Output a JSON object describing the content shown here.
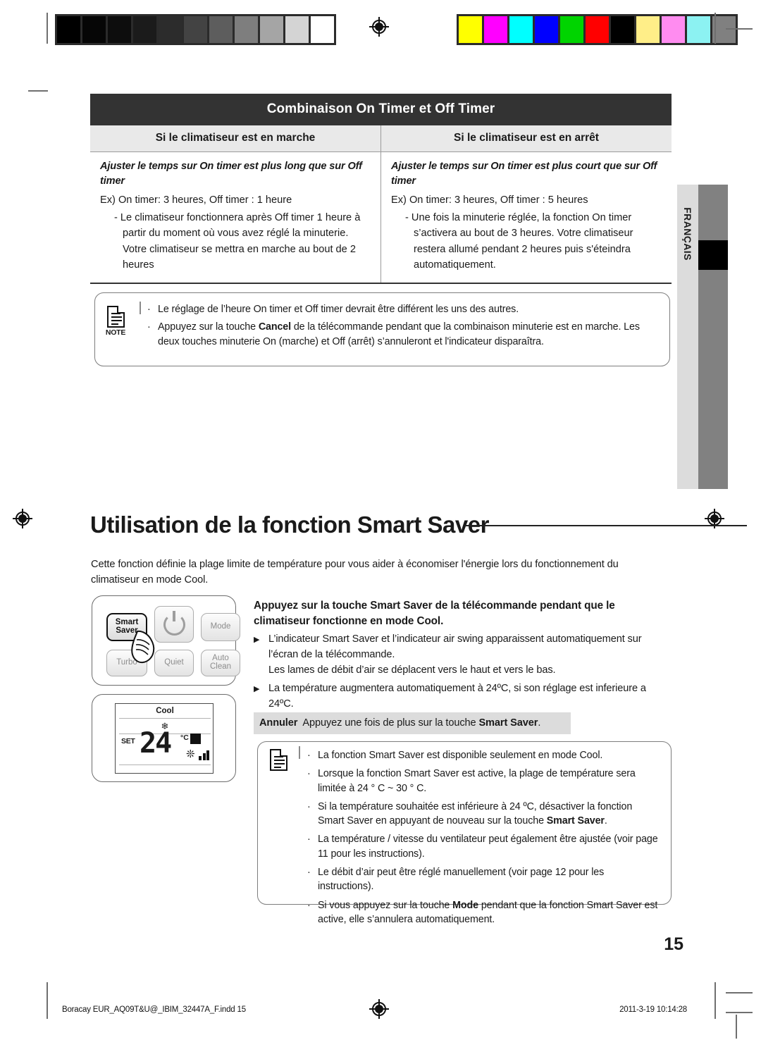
{
  "print_marks": {
    "gray_swatches": [
      "#000000",
      "#060606",
      "#0d0d0d",
      "#1b1b1b",
      "#2c2c2c",
      "#434343",
      "#5d5d5d",
      "#7e7e7e",
      "#a5a5a5",
      "#d4d4d4",
      "#ffffff"
    ],
    "color_swatches": [
      "#ffff00",
      "#ff00ff",
      "#00ffff",
      "#0000ff",
      "#00d400",
      "#ff0000",
      "#000000",
      "#ffee88",
      "#ff8cf0",
      "#8cf2f2",
      "#808080"
    ],
    "registration_icon": "registration-target-icon"
  },
  "table": {
    "title": "Combinaison On Timer et Off Timer",
    "columns": [
      {
        "header": "Si le climatiseur est en marche",
        "condition": "Ajuster le temps sur On timer est plus long que sur Off timer",
        "example": "Ex) On timer:  3 heures, Off timer : 1 heure",
        "detail": "- Le climatiseur fonctionnera après Off timer 1 heure à partir du moment où vous avez réglé la minuterie. Votre climatiseur se mettra en marche au bout de 2 heures"
      },
      {
        "header": "Si le climatiseur est en arrêt",
        "condition": "Ajuster le temps sur On timer est plus court que sur Off timer",
        "example": "Ex) On timer:  3 heures, Off timer : 5 heures",
        "detail": "- Une fois la minuterie réglée, la fonction On timer s’activera au bout de 3 heures. Votre climatiseur restera allumé pendant 2 heures puis s'éteindra automatiquement."
      }
    ]
  },
  "note_top": {
    "icon": "note-document-icon",
    "label": "NOTE",
    "items": [
      {
        "text": "Le réglage de l’heure On timer et Off timer devrait être différent les uns des autres.",
        "bold": ""
      },
      {
        "text": "Appuyez sur la touche Cancel de la télécommande pendant que la combinaison minuterie est en marche. Les deux touches minuterie On (marche) et Off (arrêt) s’annuleront et l'indicateur disparaîtra.",
        "bold": "Cancel"
      }
    ]
  },
  "section": {
    "heading": "Utilisation de la fonction Smart Saver",
    "intro": "Cette fonction définie la plage limite de température pour vous aider à économiser l'énergie lors du fonctionnement du climatiseur en mode Cool."
  },
  "remote_buttons": {
    "smart_saver": "Smart\nSaver",
    "smart_saver_line1": "Smart",
    "smart_saver_line2": "Saver",
    "power": "power-icon",
    "mode": "Mode",
    "turbo": "Turbo",
    "quiet": "Quiet",
    "auto_clean_line1": "Auto",
    "auto_clean_line2": "Clean",
    "hand": "hand-pointer-icon"
  },
  "lcd": {
    "mode": "Cool",
    "swing_icon": "air-swing-icon",
    "set_label": "SET",
    "temperature": "24",
    "unit": "°C",
    "smart_saver_indicator": "smart-saver-indicator-icon",
    "fan_icon": "fan-icon",
    "fan_bars": 3
  },
  "instructions": {
    "lead": "Appuyez sur la touche Smart Saver de la télécommande pendant que le climatiseur fonctionne en mode Cool.",
    "bullets": [
      "L’indicateur Smart Saver et l’indicateur air swing apparaissent automatiquement sur l’écran de la télécommande.\nLes lames de débit d’air se déplacent vers le haut et vers le bas.",
      "La température augmentera automatiquement à 24ºC, si son réglage est inferieure a 24ºC."
    ],
    "cancel_label": "Annuler",
    "cancel_text_pre": "Appuyez une fois de plus sur la touche ",
    "cancel_text_bold": "Smart Saver",
    "cancel_text_post": "."
  },
  "note_bottom": {
    "icon": "note-document-icon",
    "items": [
      {
        "pre": "La fonction Smart Saver est disponible seulement en mode Cool.",
        "bold": "",
        "post": ""
      },
      {
        "pre": "Lorsque la fonction Smart Saver est active, la plage de température sera limitée à 24 ° C ~ 30 ° C.",
        "bold": "",
        "post": ""
      },
      {
        "pre": "Si la température souhaitée est inférieure à 24 ºC, désactiver la fonction Smart Saver en appuyant de nouveau sur la touche ",
        "bold": "Smart Saver",
        "post": "."
      },
      {
        "pre": "La température / vitesse du ventilateur peut également être ajustée (voir page 11 pour les instructions).",
        "bold": "",
        "post": ""
      },
      {
        "pre": "Le débit d’air peut être réglé manuellement (voir page 12 pour les instructions).",
        "bold": "",
        "post": ""
      },
      {
        "pre": "Si vous appuyez sur la touche ",
        "bold": "Mode",
        "post": " pendant que la fonction Smart Saver est active, elle s’annulera automatiquement."
      }
    ]
  },
  "side_tab": {
    "language": "FRANÇAIS"
  },
  "page_number": "15",
  "footer": {
    "left": "Boracay EUR_AQ09T&U@_IBIM_32447A_F.indd   15",
    "right": "2011-3-19   10:14:28"
  }
}
